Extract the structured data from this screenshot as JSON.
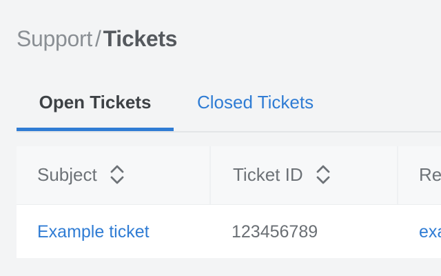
{
  "breadcrumb": {
    "parent": "Support",
    "separator": "/",
    "current": "Tickets"
  },
  "tabs": [
    {
      "label": "Open Tickets",
      "active": true
    },
    {
      "label": "Closed Tickets",
      "active": false
    }
  ],
  "table": {
    "columns": [
      {
        "label": "Subject",
        "sortable": true
      },
      {
        "label": "Ticket ID",
        "sortable": true
      },
      {
        "label": "Re",
        "sortable": false
      }
    ],
    "rows": [
      {
        "subject": "Example ticket",
        "ticket_id": "123456789",
        "requester": "exa"
      }
    ]
  },
  "colors": {
    "accent": "#2f7cd4",
    "background": "#f3f4f5",
    "header_bg": "#f7f8f9"
  },
  "icons": {
    "sort": "chevron-up-down-icon"
  }
}
